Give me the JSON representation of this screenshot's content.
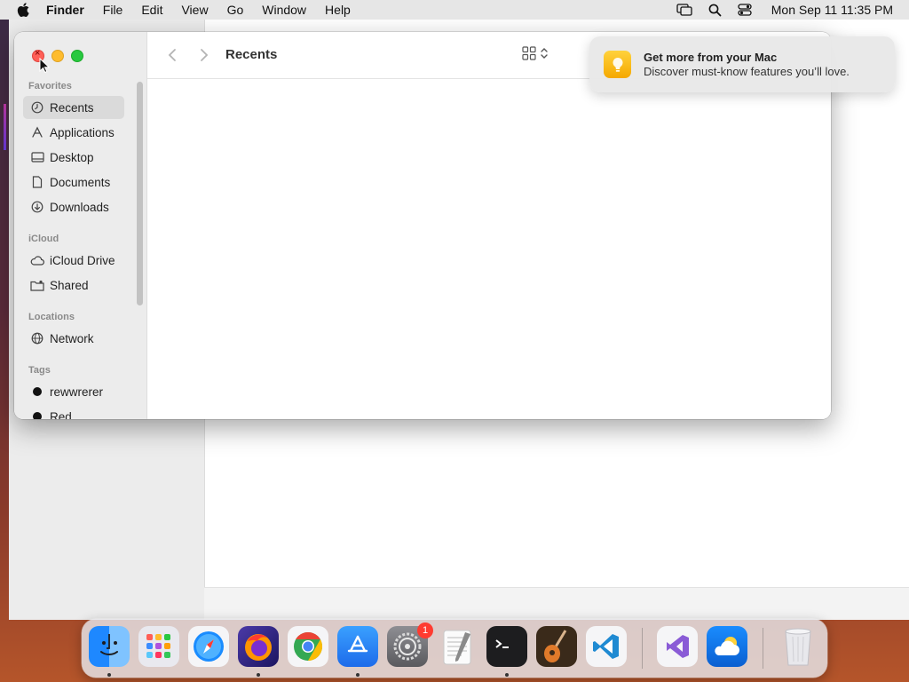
{
  "menubar": {
    "app_name": "Finder",
    "items": [
      "File",
      "Edit",
      "View",
      "Go",
      "Window",
      "Help"
    ],
    "clock": "Mon Sep 11  11:35 PM"
  },
  "finder": {
    "title": "Recents",
    "sidebar": {
      "favorites_label": "Favorites",
      "favorites": [
        "Recents",
        "Applications",
        "Desktop",
        "Documents",
        "Downloads"
      ],
      "icloud_label": "iCloud",
      "icloud": [
        "iCloud Drive",
        "Shared"
      ],
      "locations_label": "Locations",
      "locations": [
        "Network"
      ],
      "tags_label": "Tags",
      "tags": [
        "rewwrerer",
        "Red"
      ]
    }
  },
  "notification": {
    "title": "Get more from your Mac",
    "body": "Discover must-know features you’ll love."
  },
  "dock": {
    "settings_badge": "1"
  },
  "colors": {
    "close": "#ff5f57",
    "minimize": "#febc2e",
    "maximize": "#28c840",
    "selection": "#dadada"
  }
}
